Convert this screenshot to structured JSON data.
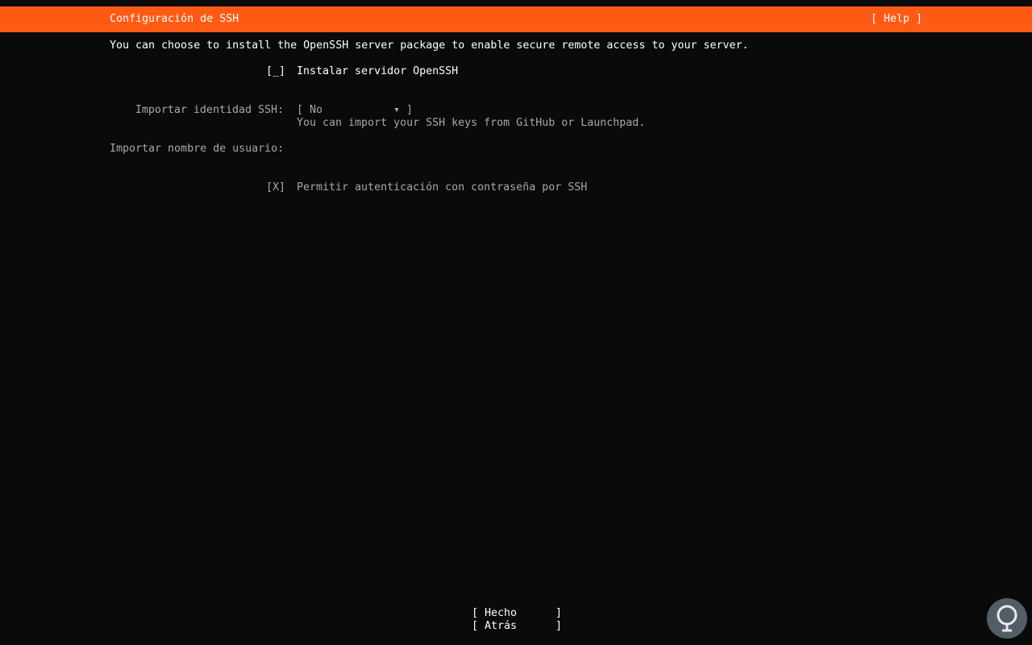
{
  "header": {
    "title": "Configuración de SSH",
    "help": "[ Help ]"
  },
  "intro": "You can choose to install the OpenSSH server package to enable secure remote access to your server.",
  "install_server": {
    "checkbox": "[_]",
    "label": "Instalar servidor OpenSSH"
  },
  "import_identity": {
    "label": "Importar identidad SSH:",
    "open_bracket": "[ ",
    "value": "No",
    "arrow": "▾",
    "close_bracket": " ]",
    "help": "You can import your SSH keys from GitHub or Launchpad."
  },
  "import_username": {
    "label": "Importar nombre de usuario:"
  },
  "password_auth": {
    "checkbox": "[X]",
    "label": "Permitir autenticación con contraseña por SSH"
  },
  "buttons": {
    "done": "Hecho",
    "back": "Atrás"
  },
  "colors": {
    "header_bg": "#ff5a13",
    "background": "#0a0a0a",
    "dim_text": "#a8a8a8"
  }
}
